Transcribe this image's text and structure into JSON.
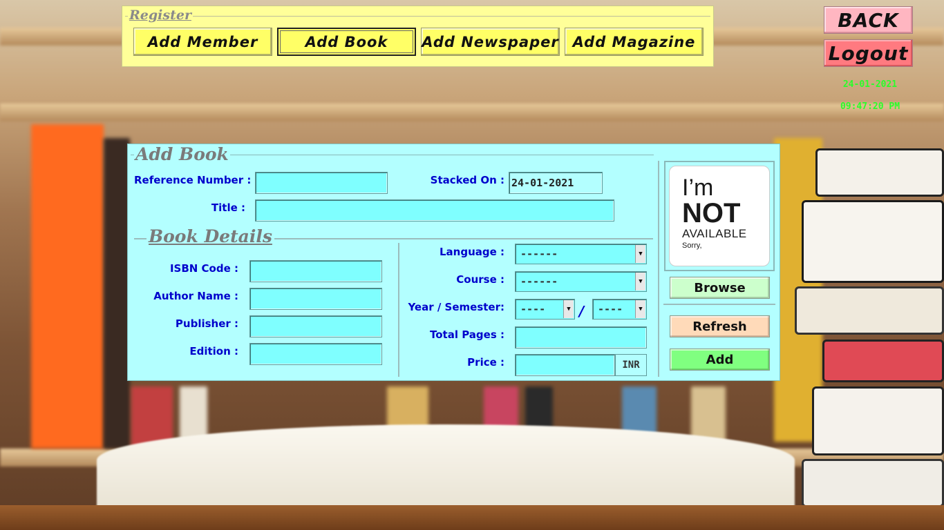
{
  "register": {
    "legend": "Register",
    "buttons": [
      "Add Member",
      "Add Book",
      "Add Newspaper",
      "Add Magazine"
    ],
    "active": "Add Book"
  },
  "side": {
    "back_label": "BACK",
    "logout_label": "Logout",
    "date": "24-01-2021",
    "time": "09:47:20 PM"
  },
  "form": {
    "title": "Add Book",
    "reference_label": "Reference Number :",
    "reference_value": "",
    "stacked_label": "Stacked On :",
    "stacked_value": "24-01-2021",
    "title_label": "Title :",
    "title_value": "",
    "details_title": "Book Details",
    "isbn_label": "ISBN Code :",
    "isbn_value": "",
    "author_label": "Author Name :",
    "author_value": "",
    "publisher_label": "Publisher :",
    "publisher_value": "",
    "edition_label": "Edition :",
    "edition_value": "",
    "language_label": "Language :",
    "language_value": "------",
    "course_label": "Course :",
    "course_value": "------",
    "year_sem_label": "Year / Semester:",
    "year_value": "----",
    "slash": "/",
    "semester_value": "----",
    "pages_label": "Total Pages :",
    "pages_value": "",
    "price_label": "Price :",
    "price_value": "",
    "currency": "INR"
  },
  "image_placeholder": {
    "line1": "I’m",
    "line2": "NOT",
    "line3": "AVAILABLE",
    "line4": "Sorry,"
  },
  "actions": {
    "browse_label": "Browse",
    "refresh_label": "Refresh",
    "add_label": "Add"
  },
  "colors": {
    "register_bg": "#ffff99",
    "form_bg": "#b3ffff",
    "field_bg": "#7fffff",
    "label_color": "#0000cc",
    "clock_color": "#29ff29",
    "back_bg": "#ffb6c1",
    "logout_bg": "#ff7a80"
  }
}
